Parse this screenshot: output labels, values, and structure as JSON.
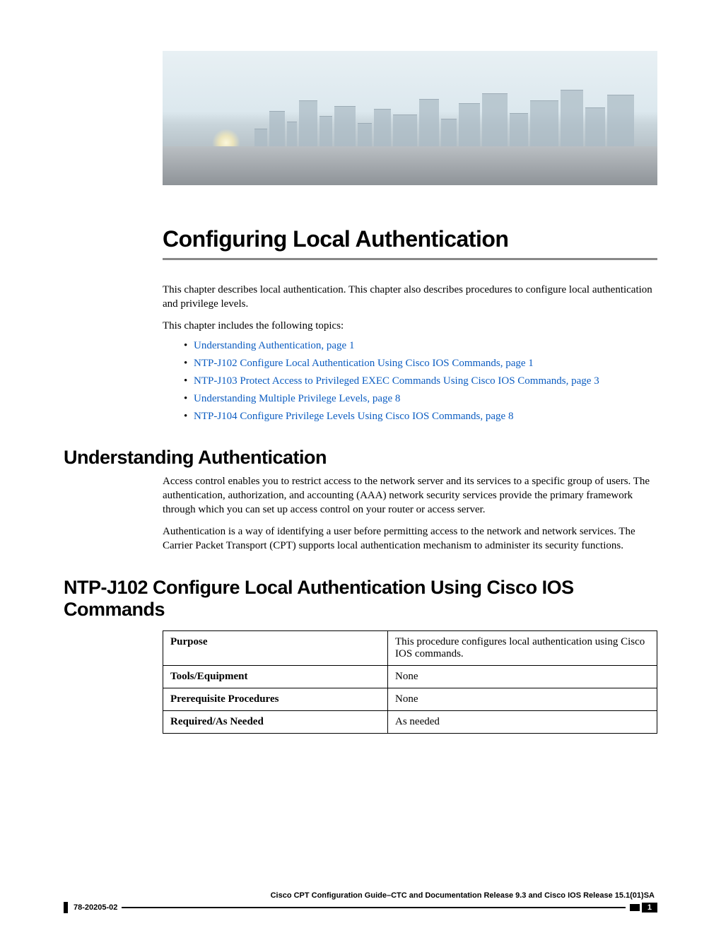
{
  "chapter": {
    "title": "Configuring Local Authentication",
    "intro_p1": "This chapter describes local authentication. This chapter also describes procedures to configure local authentication and privilege levels.",
    "intro_p2": "This chapter includes the following topics:"
  },
  "toc": [
    {
      "label": "Understanding Authentication,  page  1"
    },
    {
      "label": "NTP-J102 Configure Local Authentication Using Cisco IOS Commands,  page  1"
    },
    {
      "label": "NTP-J103 Protect Access to Privileged EXEC Commands Using Cisco IOS Commands,  page  3"
    },
    {
      "label": "Understanding Multiple Privilege Levels,  page  8"
    },
    {
      "label": "NTP-J104 Configure Privilege Levels Using Cisco IOS Commands,  page  8"
    }
  ],
  "sections": {
    "understanding": {
      "heading": "Understanding Authentication",
      "p1": "Access control enables you to restrict access to the network server and its services to a specific group of users. The authentication, authorization, and accounting (AAA) network security services provide the primary framework through which you can set up access control on your router or access server.",
      "p2": "Authentication is a way of identifying a user before permitting access to the network and network services. The Carrier Packet Transport (CPT) supports local authentication mechanism to administer its security functions."
    },
    "ntp_j102": {
      "heading": "NTP-J102 Configure Local Authentication Using Cisco IOS Commands",
      "table": [
        {
          "key": "Purpose",
          "value": "This procedure configures local authentication using Cisco IOS commands."
        },
        {
          "key": "Tools/Equipment",
          "value": "None"
        },
        {
          "key": "Prerequisite Procedures",
          "value": "None"
        },
        {
          "key": "Required/As Needed",
          "value": "As needed"
        }
      ]
    }
  },
  "footer": {
    "guide_title": "Cisco CPT Configuration Guide–CTC and Documentation Release 9.3 and Cisco IOS Release 15.1(01)SA",
    "doc_number": "78-20205-02",
    "page_number": "1"
  }
}
